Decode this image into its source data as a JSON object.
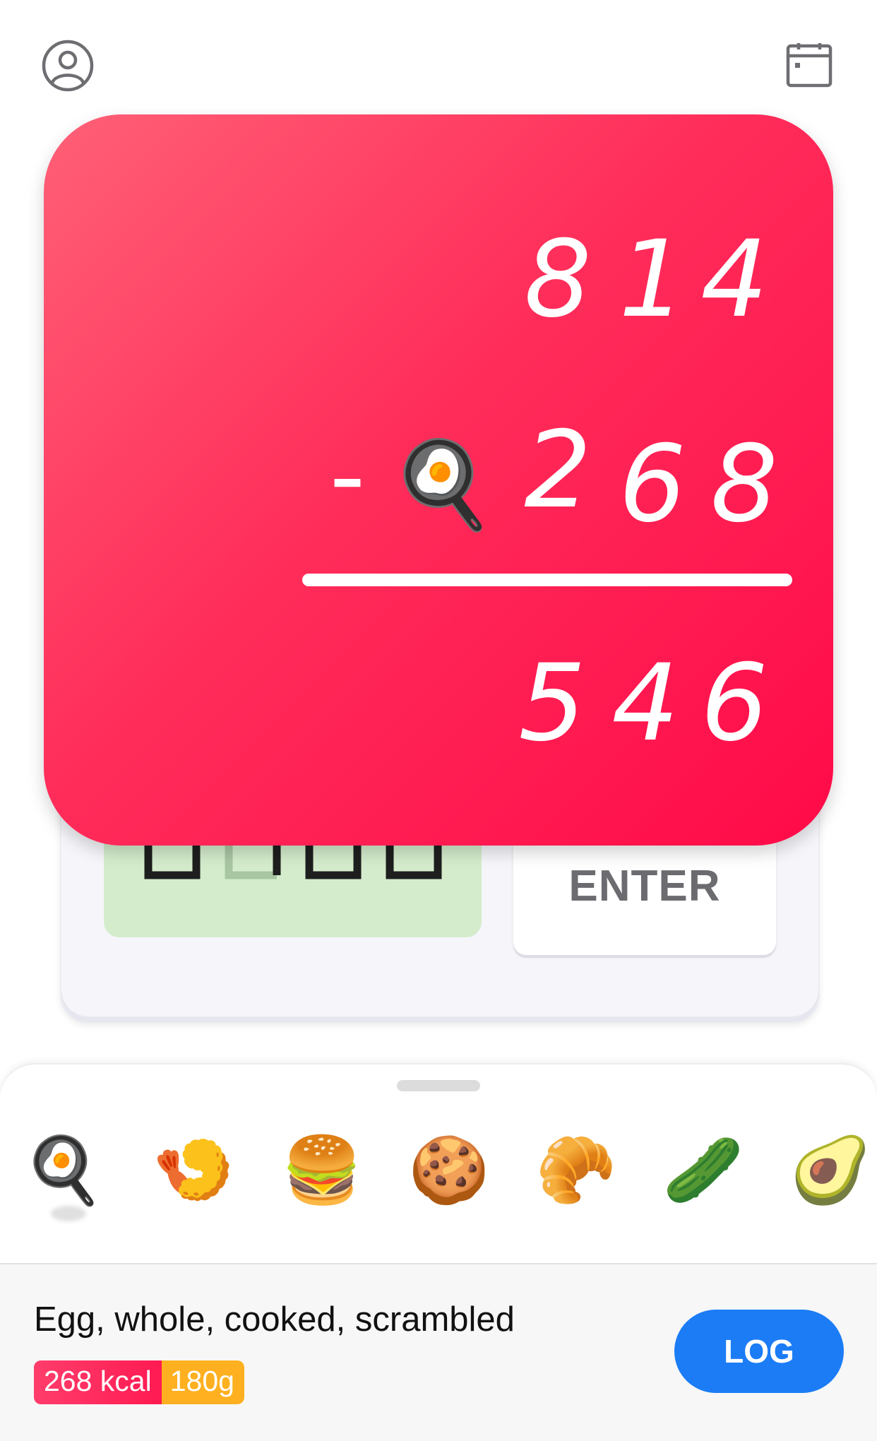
{
  "header": {
    "profile_icon": "person-circle-icon",
    "calendar_icon": "calendar-icon"
  },
  "problem": {
    "minuend": [
      "8",
      "1",
      "4"
    ],
    "operator": "-",
    "operator_emoji": "🍳",
    "subtrahend": [
      "2",
      "6",
      "8"
    ],
    "result": [
      "5",
      "4",
      "6"
    ]
  },
  "scale": {
    "display_value": "0000",
    "enter_label": "ENTER"
  },
  "foods": [
    {
      "emoji": "🍳",
      "name": "frying-pan-egg",
      "selected": true
    },
    {
      "emoji": "🍤",
      "name": "shrimp"
    },
    {
      "emoji": "🍔",
      "name": "burger"
    },
    {
      "emoji": "🍪",
      "name": "cookie"
    },
    {
      "emoji": "🥐",
      "name": "croissant"
    },
    {
      "emoji": "🥒",
      "name": "cucumber"
    },
    {
      "emoji": "🥑",
      "name": "avocado"
    }
  ],
  "selection": {
    "food_name": "Egg, whole, cooked, scrambled",
    "kcal": "268 kcal",
    "grams": "180g",
    "log_label": "LOG"
  },
  "colors": {
    "card_gradient_start": "#ff6077",
    "card_gradient_end": "#ff0a48",
    "log_button": "#1b7cf6",
    "kcal_pill": "#ff2d5a",
    "grams_pill": "#ffb020",
    "lcd_background": "#d4eccc"
  }
}
